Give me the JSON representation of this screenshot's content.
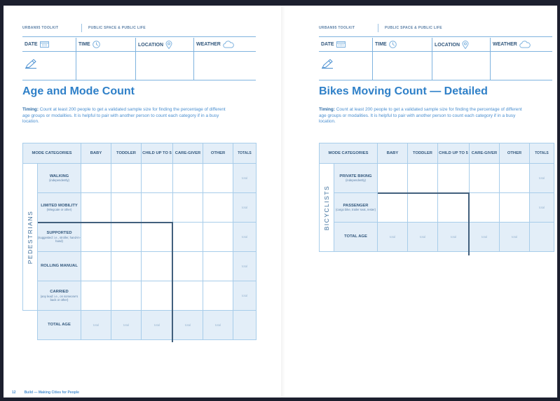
{
  "left_page": {
    "header": {
      "series": "URBAN95 TOOLKIT",
      "section": "PUBLIC SPACE & PUBLIC LIFE"
    },
    "meta_fields": {
      "date": "DATE",
      "time": "TIME",
      "location": "LOCATION",
      "weather": "WEATHER"
    },
    "title": "Age and Mode Count",
    "timing_label": "Timing:",
    "timing_text": " Count at least 200 people to get a validated sample size for finding the percentage of different age groups or modalities. It is helpful to pair with another person to count each category if in a busy location.",
    "table": {
      "columns": [
        "MODE CATEGORIES",
        "BABY",
        "TODDLER",
        "CHILD UP TO 5",
        "CARE-GIVER",
        "OTHER",
        "TOTALS"
      ],
      "group_label": "PEDESTRIANS",
      "rows": [
        {
          "label": "WALKING",
          "sub": "(independently)"
        },
        {
          "label": "LIMITED MOBILITY",
          "sub": "(Wiegcate or other)"
        },
        {
          "label": "SUPPORTED",
          "sub": "(suggested: i.e., stroller, hand-in-hand)"
        },
        {
          "label": "ROLLING MANUAL",
          "sub": ""
        },
        {
          "label": "CARRIED",
          "sub": "(any lead: i.e., on someone's back or other)"
        }
      ],
      "total_row_label": "TOTAL AGE",
      "cell_total_text": "total"
    },
    "footer": {
      "page_number": "12",
      "text": "Build — Making Cities for People"
    }
  },
  "right_page": {
    "header": {
      "series": "URBAN95 TOOLKIT",
      "section": "PUBLIC SPACE & PUBLIC LIFE"
    },
    "meta_fields": {
      "date": "DATE",
      "time": "TIME",
      "location": "LOCATION",
      "weather": "WEATHER"
    },
    "title": "Bikes Moving Count — Detailed",
    "timing_label": "Timing:",
    "timing_text": " Count at least 200 people to get a validated sample size for finding the percentage of different age groups or modalities. It is helpful to pair with another person to count each category if in a busy location.",
    "table": {
      "columns": [
        "MODE CATEGORIES",
        "BABY",
        "TODDLER",
        "CHILD UP TO 5",
        "CARE-GIVER",
        "OTHER",
        "TOTALS"
      ],
      "group_label": "BICYCLISTS",
      "rows": [
        {
          "label": "PRIVATE BIKING",
          "sub": "(independently)"
        },
        {
          "label": "PASSENGER",
          "sub": "(cargo bike, trailer seat, rester)"
        }
      ],
      "total_row_label": "TOTAL AGE",
      "cell_total_text": "total"
    }
  },
  "colors": {
    "accent_blue": "#2f80c8",
    "rule_blue": "#7fb3df",
    "header_fill": "#e3eef8",
    "divider_dark": "#42607d"
  },
  "icons": {
    "date": "calendar-icon",
    "time": "clock-icon",
    "location": "location-pin-icon",
    "weather": "cloud-icon",
    "notes": "pencil-icon"
  }
}
